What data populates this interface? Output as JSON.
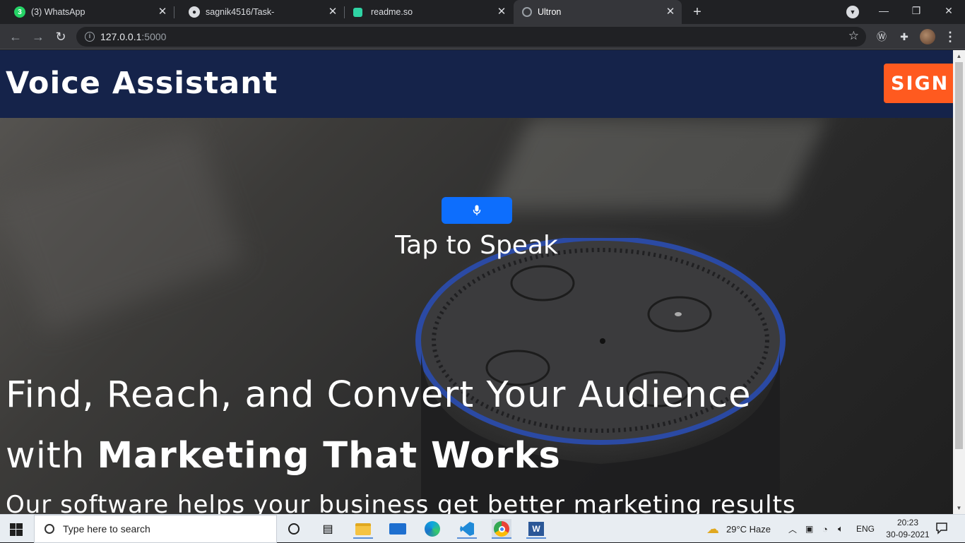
{
  "browser": {
    "tabs": [
      {
        "label": "(3) WhatsApp",
        "icon": "whatsapp-icon",
        "badge": "3"
      },
      {
        "label": "sagnik4516/Task-",
        "icon": "github-icon"
      },
      {
        "label": "readme.so",
        "icon": "readme-icon"
      },
      {
        "label": "Ultron",
        "icon": "globe-icon",
        "active": true
      }
    ],
    "url_host": "127.0.0.1",
    "url_port": ":5000"
  },
  "site": {
    "title": "Voice Assistant",
    "sign_button": "SIGN",
    "tap_label": "Tap to Speak",
    "headline_line1": "Find, Reach, and Convert Your Audience",
    "headline_with": "with ",
    "headline_bold": "Marketing That Works",
    "subline": "Our software helps your business get better marketing results"
  },
  "taskbar": {
    "search_placeholder": "Type here to search",
    "weather": "29°C  Haze",
    "language": "ENG",
    "time": "20:23",
    "date": "30-09-2021"
  },
  "colors": {
    "header_bg": "#15234a",
    "sign_accent": "#ff5a1f",
    "mic_button": "#0d6efd"
  }
}
